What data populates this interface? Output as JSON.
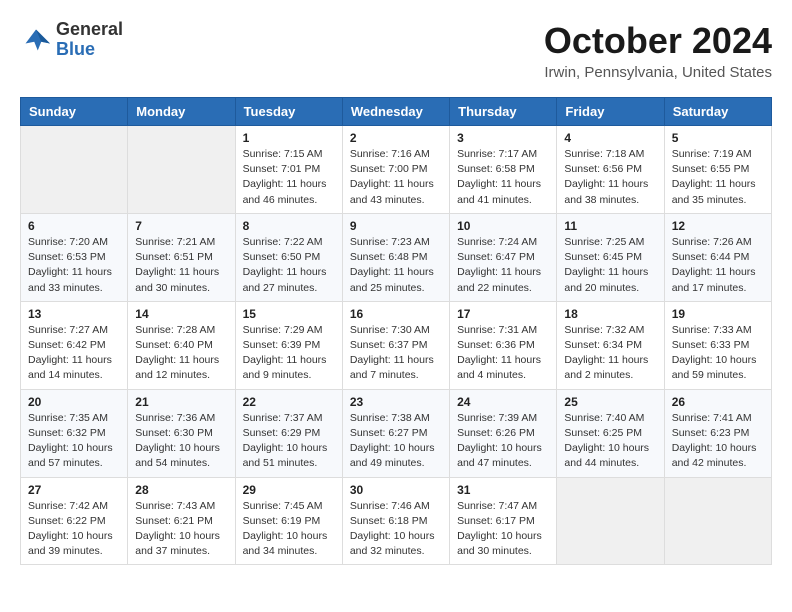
{
  "header": {
    "logo_general": "General",
    "logo_blue": "Blue",
    "month_title": "October 2024",
    "location": "Irwin, Pennsylvania, United States"
  },
  "calendar": {
    "days_of_week": [
      "Sunday",
      "Monday",
      "Tuesday",
      "Wednesday",
      "Thursday",
      "Friday",
      "Saturday"
    ],
    "weeks": [
      [
        {
          "day": "",
          "sunrise": "",
          "sunset": "",
          "daylight": ""
        },
        {
          "day": "",
          "sunrise": "",
          "sunset": "",
          "daylight": ""
        },
        {
          "day": "1",
          "sunrise": "Sunrise: 7:15 AM",
          "sunset": "Sunset: 7:01 PM",
          "daylight": "Daylight: 11 hours and 46 minutes."
        },
        {
          "day": "2",
          "sunrise": "Sunrise: 7:16 AM",
          "sunset": "Sunset: 7:00 PM",
          "daylight": "Daylight: 11 hours and 43 minutes."
        },
        {
          "day": "3",
          "sunrise": "Sunrise: 7:17 AM",
          "sunset": "Sunset: 6:58 PM",
          "daylight": "Daylight: 11 hours and 41 minutes."
        },
        {
          "day": "4",
          "sunrise": "Sunrise: 7:18 AM",
          "sunset": "Sunset: 6:56 PM",
          "daylight": "Daylight: 11 hours and 38 minutes."
        },
        {
          "day": "5",
          "sunrise": "Sunrise: 7:19 AM",
          "sunset": "Sunset: 6:55 PM",
          "daylight": "Daylight: 11 hours and 35 minutes."
        }
      ],
      [
        {
          "day": "6",
          "sunrise": "Sunrise: 7:20 AM",
          "sunset": "Sunset: 6:53 PM",
          "daylight": "Daylight: 11 hours and 33 minutes."
        },
        {
          "day": "7",
          "sunrise": "Sunrise: 7:21 AM",
          "sunset": "Sunset: 6:51 PM",
          "daylight": "Daylight: 11 hours and 30 minutes."
        },
        {
          "day": "8",
          "sunrise": "Sunrise: 7:22 AM",
          "sunset": "Sunset: 6:50 PM",
          "daylight": "Daylight: 11 hours and 27 minutes."
        },
        {
          "day": "9",
          "sunrise": "Sunrise: 7:23 AM",
          "sunset": "Sunset: 6:48 PM",
          "daylight": "Daylight: 11 hours and 25 minutes."
        },
        {
          "day": "10",
          "sunrise": "Sunrise: 7:24 AM",
          "sunset": "Sunset: 6:47 PM",
          "daylight": "Daylight: 11 hours and 22 minutes."
        },
        {
          "day": "11",
          "sunrise": "Sunrise: 7:25 AM",
          "sunset": "Sunset: 6:45 PM",
          "daylight": "Daylight: 11 hours and 20 minutes."
        },
        {
          "day": "12",
          "sunrise": "Sunrise: 7:26 AM",
          "sunset": "Sunset: 6:44 PM",
          "daylight": "Daylight: 11 hours and 17 minutes."
        }
      ],
      [
        {
          "day": "13",
          "sunrise": "Sunrise: 7:27 AM",
          "sunset": "Sunset: 6:42 PM",
          "daylight": "Daylight: 11 hours and 14 minutes."
        },
        {
          "day": "14",
          "sunrise": "Sunrise: 7:28 AM",
          "sunset": "Sunset: 6:40 PM",
          "daylight": "Daylight: 11 hours and 12 minutes."
        },
        {
          "day": "15",
          "sunrise": "Sunrise: 7:29 AM",
          "sunset": "Sunset: 6:39 PM",
          "daylight": "Daylight: 11 hours and 9 minutes."
        },
        {
          "day": "16",
          "sunrise": "Sunrise: 7:30 AM",
          "sunset": "Sunset: 6:37 PM",
          "daylight": "Daylight: 11 hours and 7 minutes."
        },
        {
          "day": "17",
          "sunrise": "Sunrise: 7:31 AM",
          "sunset": "Sunset: 6:36 PM",
          "daylight": "Daylight: 11 hours and 4 minutes."
        },
        {
          "day": "18",
          "sunrise": "Sunrise: 7:32 AM",
          "sunset": "Sunset: 6:34 PM",
          "daylight": "Daylight: 11 hours and 2 minutes."
        },
        {
          "day": "19",
          "sunrise": "Sunrise: 7:33 AM",
          "sunset": "Sunset: 6:33 PM",
          "daylight": "Daylight: 10 hours and 59 minutes."
        }
      ],
      [
        {
          "day": "20",
          "sunrise": "Sunrise: 7:35 AM",
          "sunset": "Sunset: 6:32 PM",
          "daylight": "Daylight: 10 hours and 57 minutes."
        },
        {
          "day": "21",
          "sunrise": "Sunrise: 7:36 AM",
          "sunset": "Sunset: 6:30 PM",
          "daylight": "Daylight: 10 hours and 54 minutes."
        },
        {
          "day": "22",
          "sunrise": "Sunrise: 7:37 AM",
          "sunset": "Sunset: 6:29 PM",
          "daylight": "Daylight: 10 hours and 51 minutes."
        },
        {
          "day": "23",
          "sunrise": "Sunrise: 7:38 AM",
          "sunset": "Sunset: 6:27 PM",
          "daylight": "Daylight: 10 hours and 49 minutes."
        },
        {
          "day": "24",
          "sunrise": "Sunrise: 7:39 AM",
          "sunset": "Sunset: 6:26 PM",
          "daylight": "Daylight: 10 hours and 47 minutes."
        },
        {
          "day": "25",
          "sunrise": "Sunrise: 7:40 AM",
          "sunset": "Sunset: 6:25 PM",
          "daylight": "Daylight: 10 hours and 44 minutes."
        },
        {
          "day": "26",
          "sunrise": "Sunrise: 7:41 AM",
          "sunset": "Sunset: 6:23 PM",
          "daylight": "Daylight: 10 hours and 42 minutes."
        }
      ],
      [
        {
          "day": "27",
          "sunrise": "Sunrise: 7:42 AM",
          "sunset": "Sunset: 6:22 PM",
          "daylight": "Daylight: 10 hours and 39 minutes."
        },
        {
          "day": "28",
          "sunrise": "Sunrise: 7:43 AM",
          "sunset": "Sunset: 6:21 PM",
          "daylight": "Daylight: 10 hours and 37 minutes."
        },
        {
          "day": "29",
          "sunrise": "Sunrise: 7:45 AM",
          "sunset": "Sunset: 6:19 PM",
          "daylight": "Daylight: 10 hours and 34 minutes."
        },
        {
          "day": "30",
          "sunrise": "Sunrise: 7:46 AM",
          "sunset": "Sunset: 6:18 PM",
          "daylight": "Daylight: 10 hours and 32 minutes."
        },
        {
          "day": "31",
          "sunrise": "Sunrise: 7:47 AM",
          "sunset": "Sunset: 6:17 PM",
          "daylight": "Daylight: 10 hours and 30 minutes."
        },
        {
          "day": "",
          "sunrise": "",
          "sunset": "",
          "daylight": ""
        },
        {
          "day": "",
          "sunrise": "",
          "sunset": "",
          "daylight": ""
        }
      ]
    ]
  }
}
